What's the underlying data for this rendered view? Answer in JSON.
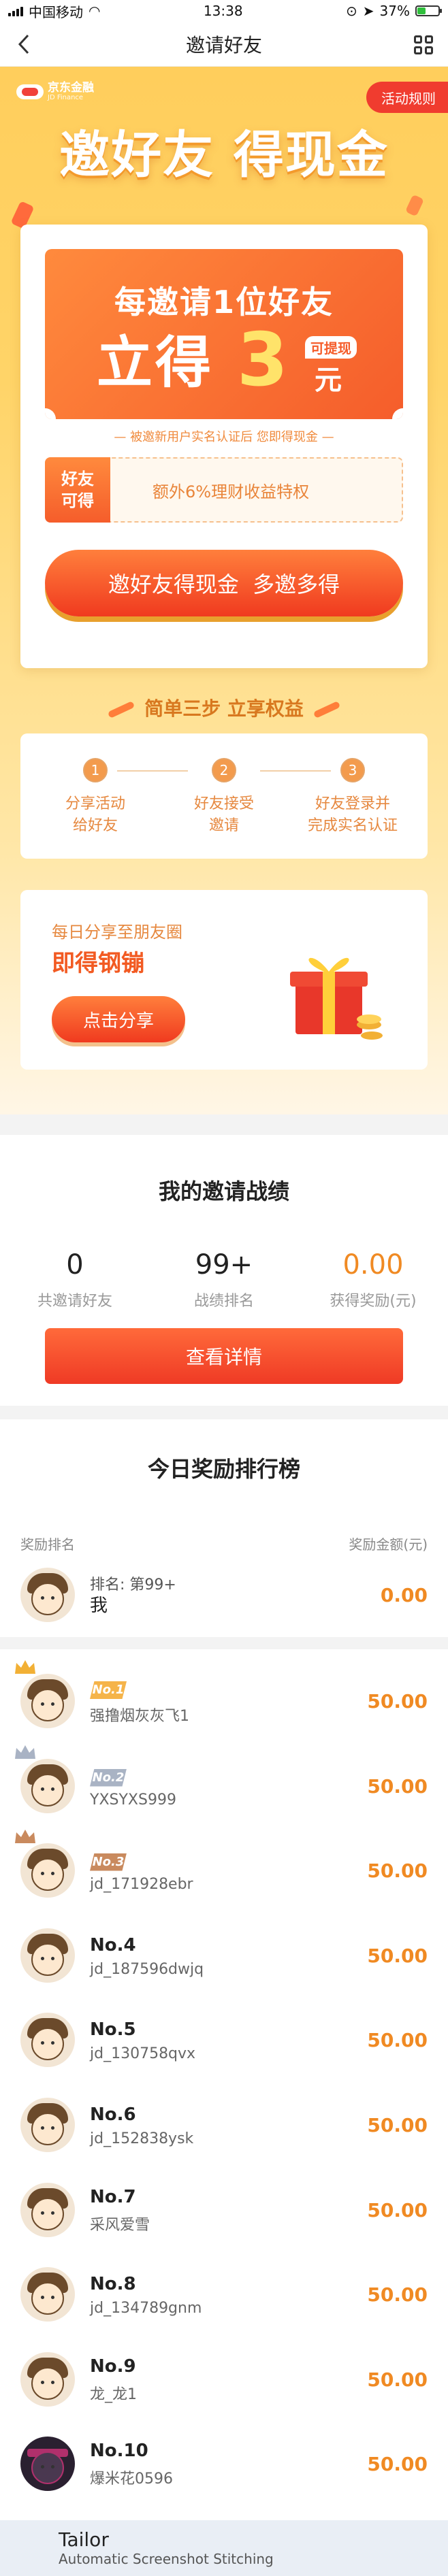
{
  "status_bar": {
    "carrier": "中国移动",
    "time": "13:38",
    "battery": "37%",
    "battery_level": 0.37
  },
  "navbar": {
    "title": "邀请好友"
  },
  "hero": {
    "logo_text": "京东金融",
    "logo_sub": "JD Finance",
    "rules_label": "活动规则",
    "headline": "邀好友 得现金",
    "ticket_line1": "每邀请1位好友",
    "ticket_prefix": "立得",
    "ticket_amount": "3",
    "ticket_unit": "元",
    "withdraw_badge": "可提现",
    "note": "— 被邀新用户实名认证后 您即得现金 —",
    "perk_tag": "好友可得",
    "perk_desc": "额外6%理财收益特权",
    "cta": "邀好友得现金  多邀多得",
    "steps_title": "简单三步 立享权益",
    "steps": [
      {
        "num": "1",
        "label": "分享活动\n给好友"
      },
      {
        "num": "2",
        "label": "好友接受\n邀请"
      },
      {
        "num": "3",
        "label": "好友登录并\n完成实名认证"
      }
    ],
    "share_line1": "每日分享至朋友圈",
    "share_line2": "即得钢镚",
    "share_button": "点击分享"
  },
  "stats": {
    "title": "我的邀请战绩",
    "items": [
      {
        "value": "0",
        "label": "共邀请好友"
      },
      {
        "value": "99+",
        "label": "战绩排名"
      },
      {
        "value": "0.00",
        "label": "获得奖励(元)"
      }
    ],
    "detail_button": "查看详情"
  },
  "leaderboard": {
    "title": "今日奖励排行榜",
    "col_rank": "奖励排名",
    "col_amount": "奖励金额(元)",
    "me": {
      "rank": "排名: 第99+",
      "name": "我",
      "amount": "0.00"
    },
    "rows": [
      {
        "rank": "No.1",
        "name": "强撸烟灰灰飞1",
        "amount": "50.00",
        "badge_color": "#f5b44a",
        "crown_color": "#f2b035"
      },
      {
        "rank": "No.2",
        "name": "YXSYXS999",
        "amount": "50.00",
        "badge_color": "#a9b3c4",
        "crown_color": "#a9b3c4"
      },
      {
        "rank": "No.3",
        "name": "jd_171928ebr",
        "amount": "50.00",
        "badge_color": "#c98a5e",
        "crown_color": "#c98a5e"
      },
      {
        "rank": "No.4",
        "name": "jd_187596dwjq",
        "amount": "50.00"
      },
      {
        "rank": "No.5",
        "name": "jd_130758qvx",
        "amount": "50.00"
      },
      {
        "rank": "No.6",
        "name": "jd_152838ysk",
        "amount": "50.00"
      },
      {
        "rank": "No.7",
        "name": "采风爱雪",
        "amount": "50.00"
      },
      {
        "rank": "No.8",
        "name": "jd_134789gnm",
        "amount": "50.00"
      },
      {
        "rank": "No.9",
        "name": "龙_龙1",
        "amount": "50.00"
      },
      {
        "rank": "No.10",
        "name": "爆米花0596",
        "amount": "50.00"
      }
    ]
  },
  "watermark": {
    "name": "Tailor",
    "desc": "Automatic Screenshot Stitching"
  }
}
